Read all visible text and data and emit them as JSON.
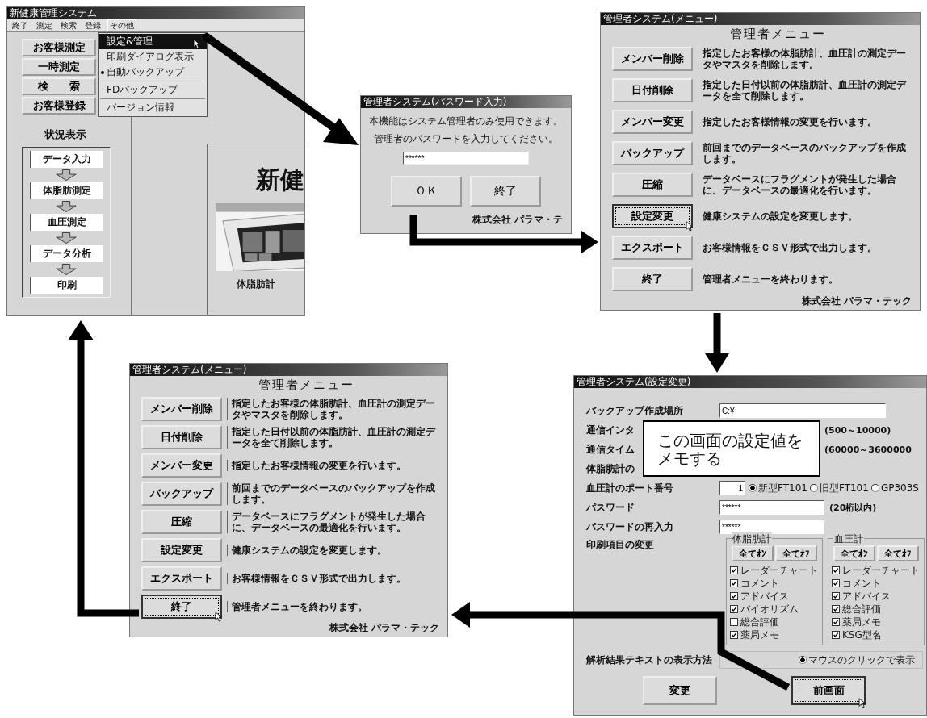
{
  "main_window": {
    "title": "新健康管理システム",
    "menu": [
      {
        "label": "終了",
        "selected": false
      },
      {
        "label": "測定",
        "selected": false
      },
      {
        "label": "検索",
        "selected": false
      },
      {
        "label": "登録",
        "selected": false
      },
      {
        "label": "その他",
        "selected": true
      }
    ],
    "dropdown": [
      {
        "label": "設定&管理",
        "selected": true,
        "checked": false,
        "separator_after": false
      },
      {
        "label": "印刷ダイアログ表示",
        "selected": false,
        "checked": false,
        "separator_after": false
      },
      {
        "label": "自動バックアップ",
        "selected": false,
        "checked": true,
        "separator_after": true
      },
      {
        "label": "FDバックアップ",
        "selected": false,
        "checked": false,
        "separator_after": true
      },
      {
        "label": "バージョン情報",
        "selected": false,
        "checked": false,
        "separator_after": false
      }
    ],
    "buttons": [
      "お客様測定",
      "一時測定",
      "検　　索",
      "お客様登録"
    ],
    "status_title": "状況表示",
    "steps": [
      "データ入力",
      "体脂肪測定",
      "血圧測定",
      "データ分析",
      "印刷"
    ],
    "splash": {
      "title": "新健",
      "caption": "体脂肪計"
    }
  },
  "password_dialog": {
    "title": "管理者システム(パスワード入力)",
    "message": [
      "本機能はシステム管理者のみ使用できます。",
      "管理者のパスワードを入力してください。"
    ],
    "password": "******",
    "buttons": [
      "ＯＫ",
      "終了"
    ],
    "footer": "株式会社 パラマ・テ"
  },
  "admin_menus": [
    {
      "title": "管理者システム(メニュー)",
      "heading": "管理者メニュー",
      "footer": "株式会社 パラマ・テック",
      "items": [
        {
          "button": "メンバー削除",
          "description": "指定したお客様の体脂肪計、血圧計の測定データやマスタを削除します。",
          "focused": false
        },
        {
          "button": "日付削除",
          "description": "指定した日付以前の体脂肪計、血圧計の測定データを全て削除します。",
          "focused": false
        },
        {
          "button": "メンバー変更",
          "description": "指定したお客様情報の変更を行います。",
          "focused": false
        },
        {
          "button": "バックアップ",
          "description": "前回までのデータベースのバックアップを作成します。",
          "focused": false
        },
        {
          "button": "圧縮",
          "description": "データベースにフラグメントが発生した場合に、データベースの最適化を行います。",
          "focused": false
        },
        {
          "button": "設定変更",
          "description": "健康システムの設定を変更します。",
          "focused": true
        },
        {
          "button": "エクスポート",
          "description": "お客様情報をＣＳＶ形式で出力します。",
          "focused": false
        },
        {
          "button": "終了",
          "description": "管理者メニューを終わります。",
          "focused": false
        }
      ]
    },
    {
      "title": "管理者システム(メニュー)",
      "heading": "管理者メニュー",
      "footer": "株式会社 パラマ・テック",
      "items": [
        {
          "button": "メンバー削除",
          "description": "指定したお客様の体脂肪計、血圧計の測定データやマスタを削除します。",
          "focused": false
        },
        {
          "button": "日付削除",
          "description": "指定した日付以前の体脂肪計、血圧計の測定データを全て削除します。",
          "focused": false
        },
        {
          "button": "メンバー変更",
          "description": "指定したお客様情報の変更を行います。",
          "focused": false
        },
        {
          "button": "バックアップ",
          "description": "前回までのデータベースのバックアップを作成します。",
          "focused": false
        },
        {
          "button": "圧縮",
          "description": "データベースにフラグメントが発生した場合に、データベースの最適化を行います。",
          "focused": false
        },
        {
          "button": "設定変更",
          "description": "健康システムの設定を変更します。",
          "focused": false
        },
        {
          "button": "エクスポート",
          "description": "お客様情報をＣＳＶ形式で出力します。",
          "focused": false
        },
        {
          "button": "終了",
          "description": "管理者メニューを終わります。",
          "focused": true
        }
      ]
    }
  ],
  "settings_window": {
    "title": "管理者システム(設定変更)",
    "backup_location": {
      "label": "バックアップ作成場所",
      "value": "C:¥"
    },
    "covered_rows": [
      {
        "label": "通信インタ",
        "note": "(500～10000)"
      },
      {
        "label": "通信タイム",
        "note": "(60000～3600000"
      },
      {
        "label": "体脂肪計の"
      }
    ],
    "bp_port": {
      "label": "血圧計のポート番号",
      "value": "1",
      "options": [
        {
          "label": "新型FT101",
          "selected": true
        },
        {
          "label": "旧型FT101",
          "selected": false
        },
        {
          "label": "GP303S",
          "selected": false
        }
      ]
    },
    "password": {
      "label": "パスワード",
      "value": "******",
      "note": "(20桁以内)"
    },
    "password_confirm": {
      "label": "パスワードの再入力",
      "value": "******"
    },
    "print_items": {
      "label": "印刷項目の変更",
      "groups": [
        {
          "title": "体脂肪計",
          "buttons": [
            "全てｵﾝ",
            "全てｵﾌ"
          ],
          "items": [
            {
              "label": "レーダーチャート",
              "checked": true
            },
            {
              "label": "コメント",
              "checked": true
            },
            {
              "label": "アドバイス",
              "checked": true
            },
            {
              "label": "バイオリズム",
              "checked": true
            },
            {
              "label": "総合評価",
              "checked": false
            },
            {
              "label": "薬局メモ",
              "checked": true
            }
          ]
        },
        {
          "title": "血圧計",
          "buttons": [
            "全てｵﾝ",
            "全てｵﾌ"
          ],
          "items": [
            {
              "label": "レーダーチャート",
              "checked": true
            },
            {
              "label": "コメント",
              "checked": true
            },
            {
              "label": "アドバイス",
              "checked": true
            },
            {
              "label": "総合評価",
              "checked": true
            },
            {
              "label": "薬局メモ",
              "checked": true
            },
            {
              "label": "KSG型名",
              "checked": true
            }
          ]
        }
      ]
    },
    "display_method": {
      "label": "解析結果テキストの表示方法",
      "options": [
        {
          "label": "マウスのクリックで表示",
          "selected": true
        }
      ]
    },
    "buttons": [
      {
        "label": "変更",
        "focused": false
      },
      {
        "label": "前画面",
        "focused": true
      }
    ],
    "callout": "この画面の設定値をメモする"
  }
}
